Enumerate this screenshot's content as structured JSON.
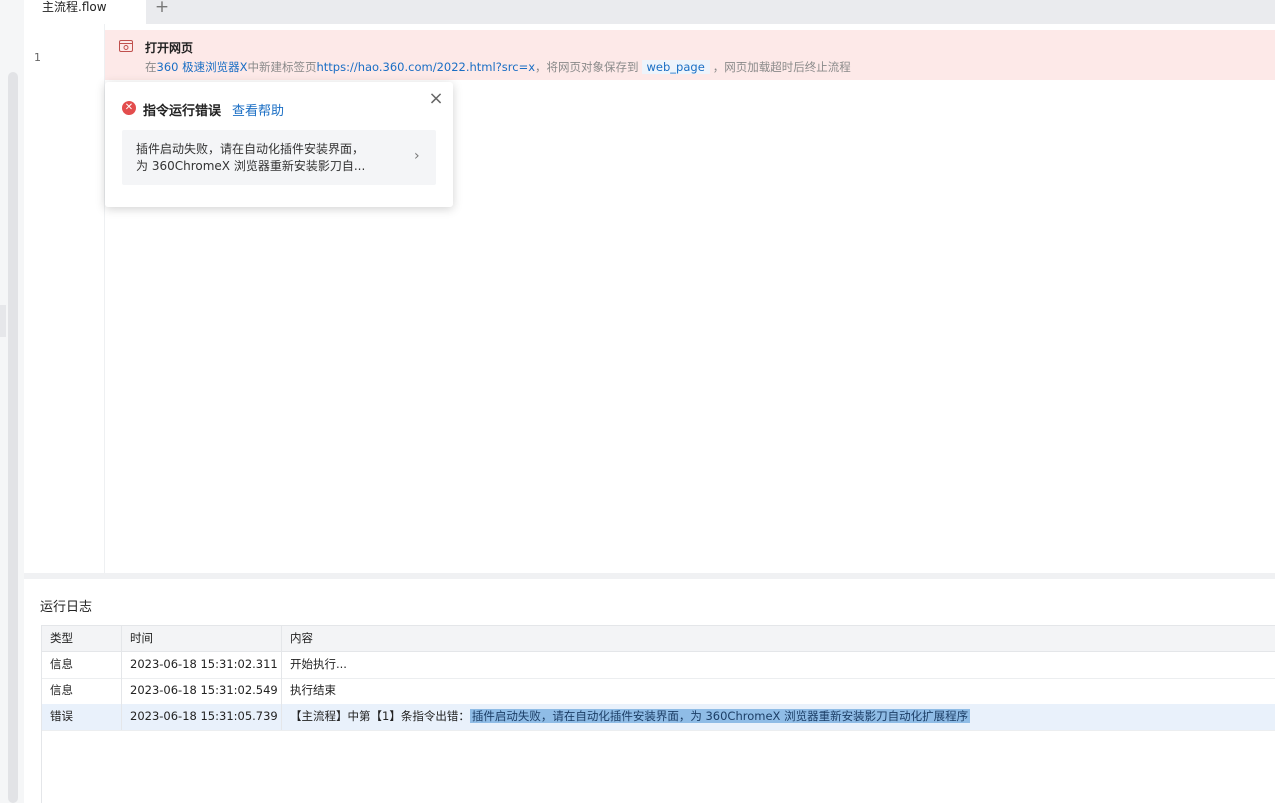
{
  "tabs": {
    "active": "主流程.flow",
    "add_icon": "plus-icon"
  },
  "editor": {
    "line_number": "1",
    "step": {
      "icon": "browser-window-icon",
      "title": "打开网页",
      "desc_pre": "在",
      "browser": "360 极速浏览器X",
      "desc_mid": "中新建标签页",
      "url": "https://hao.360.com/2022.html?src=x",
      "desc_mid2": "，将网页对象保存到",
      "variable": "web_page",
      "desc_post": "，网页加载超时后终止流程"
    }
  },
  "popup": {
    "icon": "error-circle-icon",
    "title": "指令运行错误",
    "help_link": "查看帮助",
    "close_icon": "close-icon",
    "message_line1": "插件启动失败，请在自动化插件安装界面，",
    "message_line2": "为 360ChromeX 浏览器重新安装影刀自...",
    "chevron_icon": "chevron-right-icon"
  },
  "log": {
    "title": "运行日志",
    "columns": [
      "类型",
      "时间",
      "内容"
    ],
    "rows": [
      {
        "type": "信息",
        "time": "2023-06-18 15:31:02.311",
        "content": "开始执行..."
      },
      {
        "type": "信息",
        "time": "2023-06-18 15:31:02.549",
        "content": "执行结束"
      },
      {
        "type": "错误",
        "time": "2023-06-18 15:31:05.739",
        "content": "【主流程】中第【1】条指令出错：",
        "highlighted": "插件启动失败，请在自动化插件安装界面，为 360ChromeX 浏览器重新安装影刀自动化扩展程序"
      }
    ]
  },
  "colors": {
    "error_row_bg": "#fde9e8",
    "link": "#1a6ec4",
    "error_icon": "#e34d4d",
    "selection": "#8fbce6"
  }
}
